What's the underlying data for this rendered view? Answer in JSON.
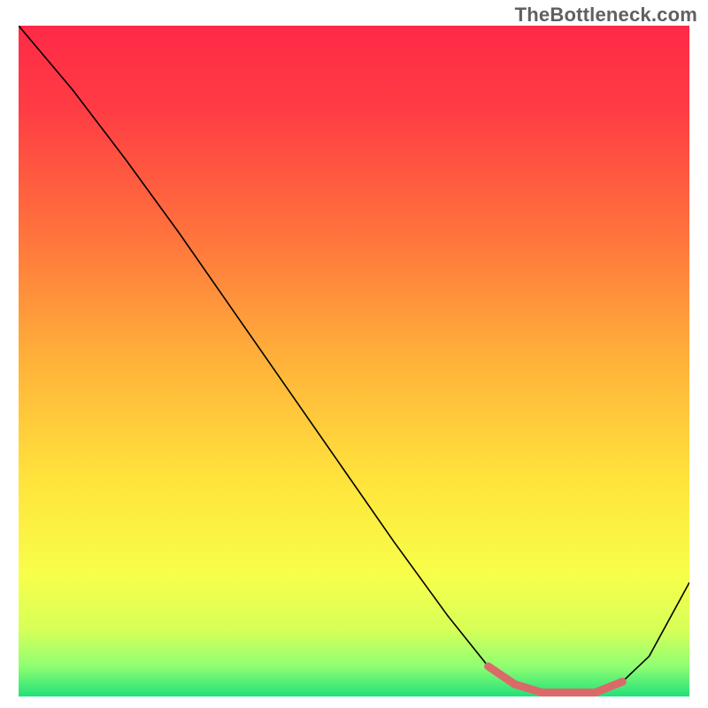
{
  "watermark": "TheBottleneck.com",
  "chart_data": {
    "type": "line",
    "title": "",
    "xlabel": "",
    "ylabel": "",
    "xlim": [
      0,
      100
    ],
    "ylim": [
      0,
      100
    ],
    "series": [
      {
        "name": "curve",
        "color": "#000000",
        "width": 1.6,
        "x": [
          0,
          8,
          16,
          24,
          32,
          40,
          48,
          56,
          64,
          70,
          74,
          78,
          82,
          86,
          90,
          94,
          100
        ],
        "y": [
          100,
          90.5,
          80,
          69,
          57.5,
          46,
          34.5,
          23,
          12,
          4.5,
          1.8,
          0.6,
          0.6,
          0.6,
          2.2,
          6,
          17
        ]
      },
      {
        "name": "highlight",
        "color": "#da6a6a",
        "width": 9,
        "x": [
          70,
          74,
          78,
          82,
          86,
          90
        ],
        "y": [
          4.5,
          1.8,
          0.6,
          0.6,
          0.6,
          2.2
        ]
      }
    ],
    "gradient_stops": [
      {
        "offset": 0.0,
        "color": "#ff2a46"
      },
      {
        "offset": 0.12,
        "color": "#ff3b44"
      },
      {
        "offset": 0.3,
        "color": "#ff6f3d"
      },
      {
        "offset": 0.5,
        "color": "#ffb23a"
      },
      {
        "offset": 0.68,
        "color": "#ffe43c"
      },
      {
        "offset": 0.82,
        "color": "#f7ff4a"
      },
      {
        "offset": 0.9,
        "color": "#d7ff58"
      },
      {
        "offset": 0.955,
        "color": "#8fff72"
      },
      {
        "offset": 1.0,
        "color": "#22e07a"
      }
    ]
  }
}
